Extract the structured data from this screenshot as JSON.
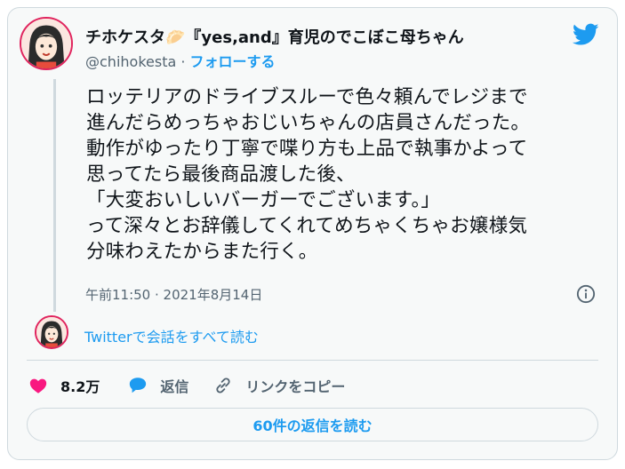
{
  "tweet": {
    "author_name": "チホケスタ🥟『yes,and』育児のでこぼこ母ちゃん",
    "handle": "@chihokesta",
    "separator": "·",
    "follow_label": "フォローする",
    "text_lines": [
      "ロッテリアのドライブスルーで色々頼んでレジまで",
      "進んだらめっちゃおじいちゃんの店員さんだった。",
      "動作がゆったり丁寧で喋り方も上品で執事かよって",
      "思ってたら最後商品渡した後、",
      "「大変おいしいバーガーでございます。」",
      "って深々とお辞儀してくれてめちゃくちゃお嬢様気",
      "分味わえたからまた行く。"
    ],
    "timestamp": "午前11:50 · 2021年8月14日",
    "conversation_link": "Twitterで会話をすべて読む",
    "likes_count": "8.2万",
    "reply_label": "返信",
    "copy_link_label": "リンクをコピー",
    "read_replies_label": "60件の返信を読む"
  },
  "icons": {
    "brand": "twitter-bird-icon",
    "info": "info-icon",
    "like": "heart-icon",
    "reply": "reply-bubble-icon",
    "link": "link-icon"
  },
  "colors": {
    "accent": "#1d9bf0",
    "like": "#f91880",
    "muted": "#536471",
    "border": "#cfd9de",
    "background": "#f7f9f9"
  }
}
